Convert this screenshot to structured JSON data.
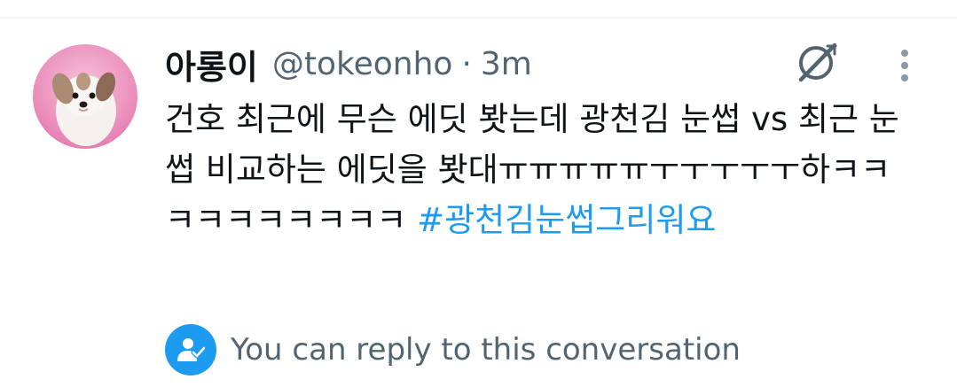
{
  "tweet": {
    "display_name": "아롱이",
    "handle": "@tokeonho",
    "separator": "·",
    "time": "3m",
    "text": "건호 최근에 무슨 에딧 봣는데 광천김 눈썹 vs 최근 눈썹 비교하는 에딧을 봣대ㅠㅠㅠㅠㅠㅜㅜㅜㅜㅜ하ㅋㅋㅋㅋㅋㅋㅋㅋㅋㅋ ",
    "hashtag": "#광천김눈썹그리워요"
  },
  "reply": {
    "label": "You can reply to this conversation"
  },
  "icons": {
    "avatar": "puppy-avatar",
    "grok": "grok-icon",
    "more": "more-vertical-icon",
    "reply": "person-check-icon"
  },
  "colors": {
    "accent": "#1d9bf0",
    "secondary_text": "#536471",
    "primary_text": "#0f1419"
  }
}
